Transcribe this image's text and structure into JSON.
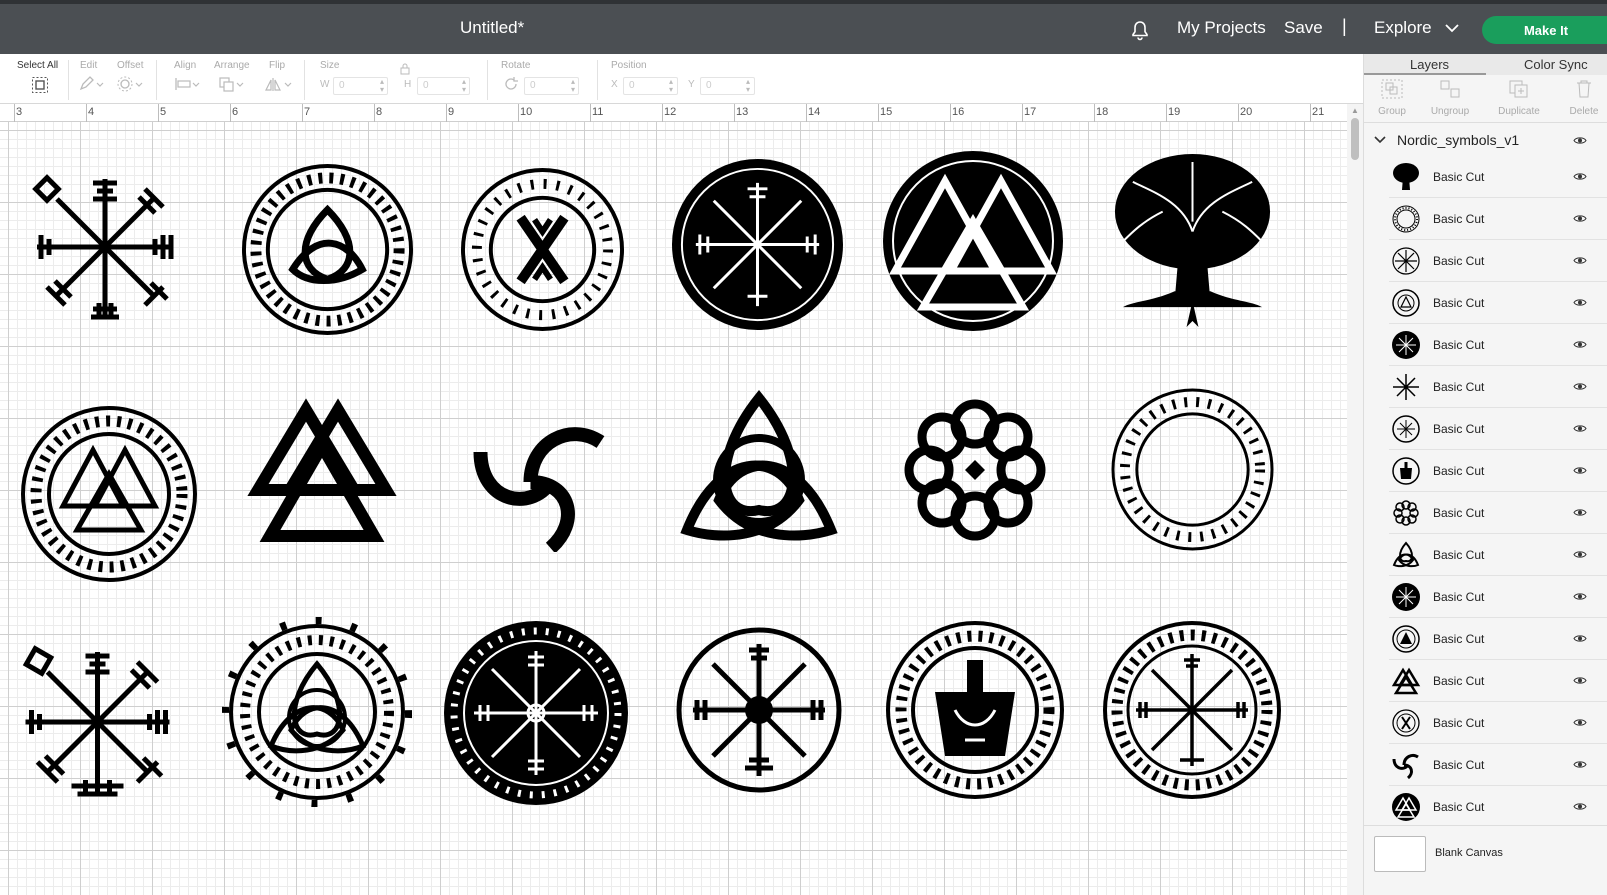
{
  "header": {
    "title": "Untitled*",
    "bell_icon": "bell-icon",
    "my_projects": "My Projects",
    "save": "Save",
    "separator": "|",
    "explore": "Explore",
    "make_it": "Make It",
    "colors": {
      "bar": "#4b4f53",
      "make_it": "#1a9e5c"
    }
  },
  "toolbar": {
    "select_all": "Select All",
    "edit": "Edit",
    "offset": "Offset",
    "align": "Align",
    "arrange": "Arrange",
    "flip": "Flip",
    "size": "Size",
    "w_label": "W",
    "w_placeholder": "0",
    "h_label": "H",
    "h_placeholder": "0",
    "rotate": "Rotate",
    "rotate_placeholder": "0",
    "position": "Position",
    "x_label": "X",
    "x_placeholder": "0",
    "y_label": "Y",
    "y_placeholder": "0"
  },
  "ruler": {
    "numbers": [
      "3",
      "4",
      "5",
      "6",
      "7",
      "8",
      "9",
      "10",
      "11",
      "12",
      "13",
      "14",
      "15",
      "16",
      "17",
      "18",
      "19",
      "20",
      "21"
    ]
  },
  "canvas": {
    "symbols": [
      {
        "name": "vegvisir-symbol"
      },
      {
        "name": "runic-triquetra-circle-symbol"
      },
      {
        "name": "runic-x-circle-symbol"
      },
      {
        "name": "vegvisir-black-disc-symbol"
      },
      {
        "name": "valknut-black-disc-symbol"
      },
      {
        "name": "tree-of-life-symbol"
      },
      {
        "name": "runic-valknut-circle-symbol"
      },
      {
        "name": "valknut-symbol"
      },
      {
        "name": "triple-horn-symbol"
      },
      {
        "name": "triquetra-symbol"
      },
      {
        "name": "celtic-knot-flower-symbol"
      },
      {
        "name": "runic-ring-symbol"
      },
      {
        "name": "vegvisir-large-symbol"
      },
      {
        "name": "triquetra-runic-ornate-symbol"
      },
      {
        "name": "aegishjalmur-black-disc-symbol"
      },
      {
        "name": "vegvisir-circle-symbol"
      },
      {
        "name": "mjolnir-runic-circle-symbol"
      },
      {
        "name": "vegvisir-runic-circle-symbol"
      }
    ]
  },
  "panel": {
    "tabs": [
      "Layers",
      "Color Sync"
    ],
    "actions": [
      "Group",
      "Ungroup",
      "Duplicate",
      "Delete"
    ],
    "group_name": "Nordic_symbols_v1",
    "layers": [
      {
        "label": "Basic Cut",
        "icon": "tree-of-life-thumb-icon"
      },
      {
        "label": "Basic Cut",
        "icon": "runic-ring-thumb-icon"
      },
      {
        "label": "Basic Cut",
        "icon": "vegvisir-circle-thumb-icon"
      },
      {
        "label": "Basic Cut",
        "icon": "triquetra-runic-thumb-icon"
      },
      {
        "label": "Basic Cut",
        "icon": "aegishjalmur-thumb-icon"
      },
      {
        "label": "Basic Cut",
        "icon": "vegvisir-thumb-icon"
      },
      {
        "label": "Basic Cut",
        "icon": "vegvisir-runic-thumb-icon"
      },
      {
        "label": "Basic Cut",
        "icon": "mjolnir-thumb-icon"
      },
      {
        "label": "Basic Cut",
        "icon": "celtic-knot-thumb-icon"
      },
      {
        "label": "Basic Cut",
        "icon": "triquetra-thumb-icon"
      },
      {
        "label": "Basic Cut",
        "icon": "vegvisir-disc-thumb-icon"
      },
      {
        "label": "Basic Cut",
        "icon": "runic-valknut-thumb-icon"
      },
      {
        "label": "Basic Cut",
        "icon": "valknut-thumb-icon"
      },
      {
        "label": "Basic Cut",
        "icon": "runic-x-thumb-icon"
      },
      {
        "label": "Basic Cut",
        "icon": "triple-horn-thumb-icon"
      },
      {
        "label": "Basic Cut",
        "icon": "valknut-disc-thumb-icon"
      }
    ],
    "blank_canvas": "Blank Canvas"
  }
}
